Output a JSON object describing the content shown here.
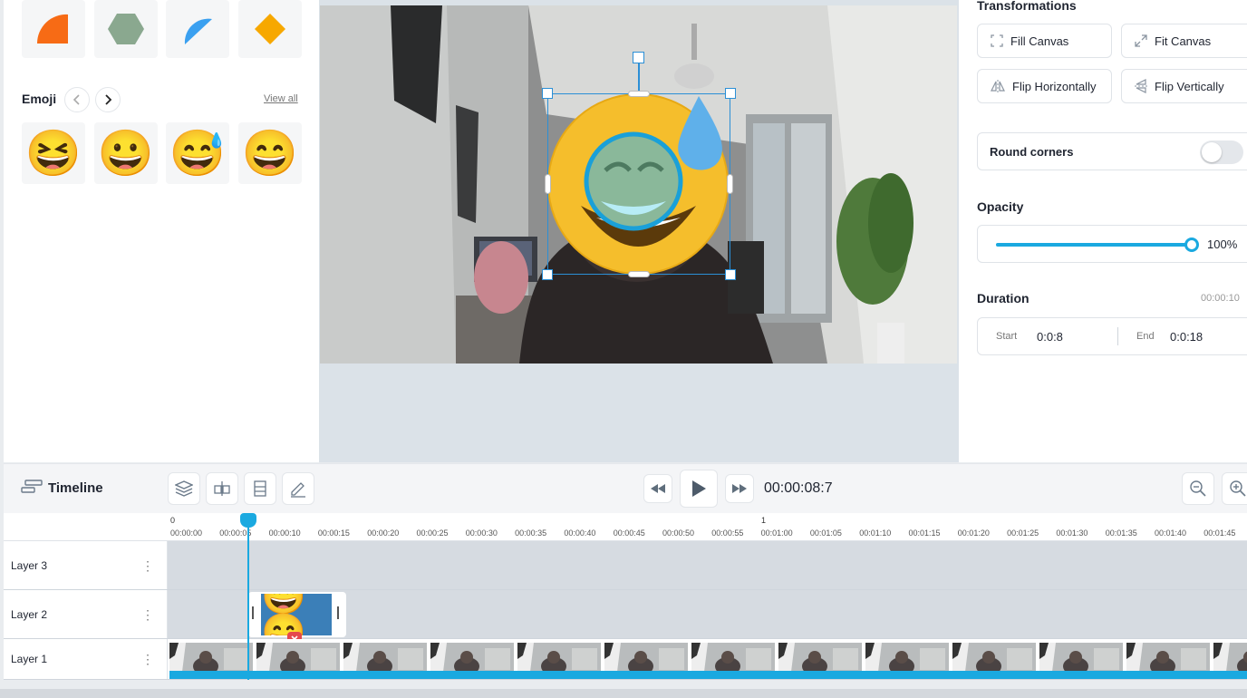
{
  "left_panel": {
    "emoji": {
      "title": "Emoji",
      "view_all": "View all",
      "items": [
        "😆",
        "😀",
        "😅",
        "😄"
      ]
    }
  },
  "right_panel": {
    "transformations": {
      "title": "Transformations",
      "fill_canvas": "Fill Canvas",
      "fit_canvas": "Fit Canvas",
      "flip_horizontally": "Flip Horizontally",
      "flip_vertically": "Flip Vertically"
    },
    "round_corners": {
      "label": "Round corners",
      "enabled": false
    },
    "opacity": {
      "title": "Opacity",
      "value_label": "100%",
      "value": 1.0
    },
    "duration": {
      "title": "Duration",
      "total": "00:00:10",
      "start_label": "Start",
      "start_value": "0:0:8",
      "end_label": "End",
      "end_value": "0:0:18"
    }
  },
  "timeline": {
    "title": "Timeline",
    "current_time": "00:00:08:7",
    "minute_markers": [
      "0",
      "1"
    ],
    "ticks": [
      "00:00:00",
      "00:00:05",
      "00:00:10",
      "00:00:15",
      "00:00:20",
      "00:00:25",
      "00:00:30",
      "00:00:35",
      "00:00:40",
      "00:00:45",
      "00:00:50",
      "00:00:55",
      "00:01:00",
      "00:01:05",
      "00:01:10",
      "00:01:15",
      "00:01:20",
      "00:01:25",
      "00:01:30",
      "00:01:35",
      "00:01:40",
      "00:01:45"
    ],
    "layers": [
      {
        "name": "Layer 3"
      },
      {
        "name": "Layer 2",
        "clip_emoji": "😅😄"
      },
      {
        "name": "Layer 1"
      }
    ]
  },
  "canvas": {
    "overlay_emoji": "😅"
  },
  "colors": {
    "accent": "#1aa9e0",
    "selection": "#2b8fd6",
    "delete": "#e5484d"
  }
}
